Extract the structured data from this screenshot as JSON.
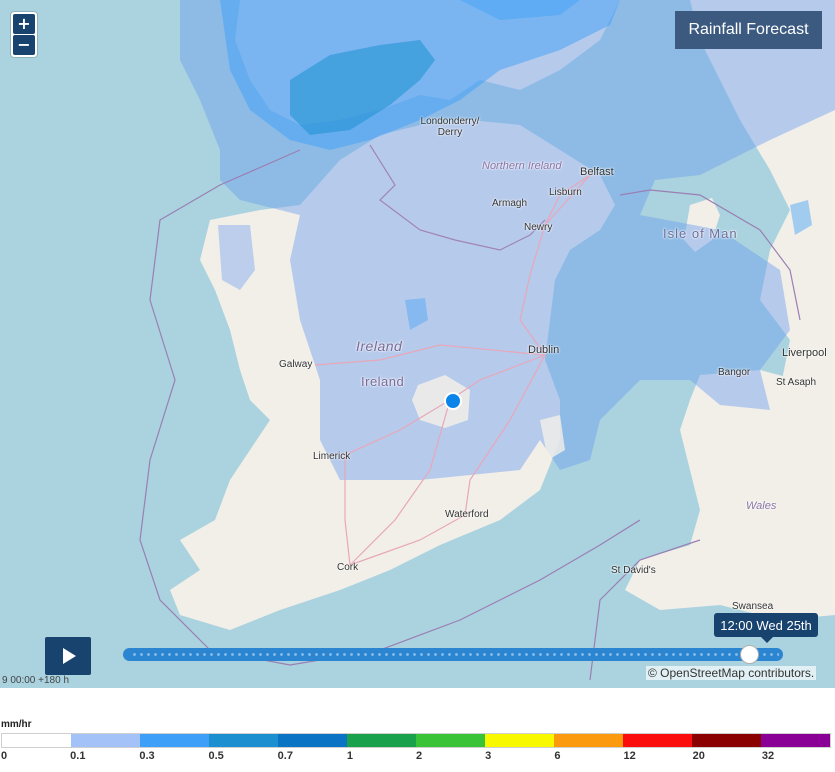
{
  "title": "Rainfall Forecast",
  "zoom": {
    "in_label": "+",
    "out_label": "−"
  },
  "timeline": {
    "current_time": "12:00 Wed 25th",
    "range_label": "9 00:00 +180 h",
    "progress": 0.96
  },
  "attribution": "© OpenStreetMap contributors.",
  "places": {
    "londonderry": "Londonderry/\nDerry",
    "northern_ireland": "Northern Ireland",
    "belfast": "Belfast",
    "lisburn": "Lisburn",
    "armagh": "Armagh",
    "newry": "Newry",
    "isle_of_man": "Isle of Man",
    "ireland_italic": "Ireland",
    "ireland": "Ireland",
    "galway": "Galway",
    "dublin": "Dublin",
    "limerick": "Limerick",
    "waterford": "Waterford",
    "cork": "Cork",
    "liverpool": "Liverpool",
    "bangor": "Bangor",
    "st_asaph": "St Asaph",
    "wales": "Wales",
    "st_davids": "St David's",
    "swansea": "Swansea"
  },
  "colors": {
    "sea": "#aad3df",
    "land": "#f2efe9",
    "accent": "#18436f",
    "title_bg": "#3c5a80"
  },
  "legend": {
    "unit": "mm/hr",
    "values": [
      "0",
      "0.1",
      "0.3",
      "0.5",
      "0.7",
      "1",
      "2",
      "3",
      "6",
      "12",
      "20",
      "32"
    ],
    "colors": [
      "#ffffff",
      "#a3c2f7",
      "#3d9ff7",
      "#1b8fcf",
      "#0b73c3",
      "#1aa14b",
      "#39c338",
      "#f8f800",
      "#fb9a0f",
      "#fb0d0d",
      "#8b0000",
      "#8a0096"
    ]
  }
}
